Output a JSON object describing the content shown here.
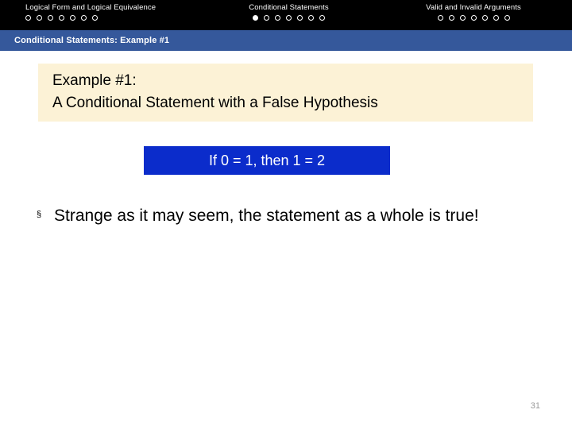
{
  "slide": {
    "page_number": "31"
  },
  "topnav": {
    "groups": [
      {
        "title": "Logical Form and Logical Equivalence",
        "dots": [
          {
            "state": "empty"
          },
          {
            "state": "empty"
          },
          {
            "state": "empty"
          },
          {
            "state": "empty"
          },
          {
            "state": "empty"
          },
          {
            "state": "empty"
          },
          {
            "state": "empty"
          }
        ]
      },
      {
        "title": "Conditional Statements",
        "dots": [
          {
            "state": "filled"
          },
          {
            "state": "empty"
          },
          {
            "state": "empty"
          },
          {
            "state": "empty"
          },
          {
            "state": "empty"
          },
          {
            "state": "empty"
          },
          {
            "state": "empty"
          }
        ]
      },
      {
        "title": "Valid and Invalid Arguments",
        "dots": [
          {
            "state": "empty"
          },
          {
            "state": "empty"
          },
          {
            "state": "empty"
          },
          {
            "state": "empty"
          },
          {
            "state": "empty"
          },
          {
            "state": "empty"
          },
          {
            "state": "empty"
          }
        ]
      }
    ]
  },
  "breadcrumb": {
    "label": "Conditional Statements: Example #1"
  },
  "callout": {
    "line1": "Example #1:",
    "line2": "A Conditional Statement with a False Hypothesis"
  },
  "statement": {
    "text": "If 0 = 1, then 1 = 2"
  },
  "body": {
    "bullet_marker": "§",
    "bullet_text": "Strange as it may seem, the statement as a whole is true!"
  },
  "colors": {
    "topbar_background": "#000000",
    "breadcrumb_background": "#35589B",
    "callout_background": "#FCF2D6",
    "statement_background": "#0B2CCB",
    "slide_background": "#FFFFFF",
    "text_primary": "#000000",
    "text_inverse": "#FFFFFF",
    "page_number": "#9A9A9A"
  }
}
